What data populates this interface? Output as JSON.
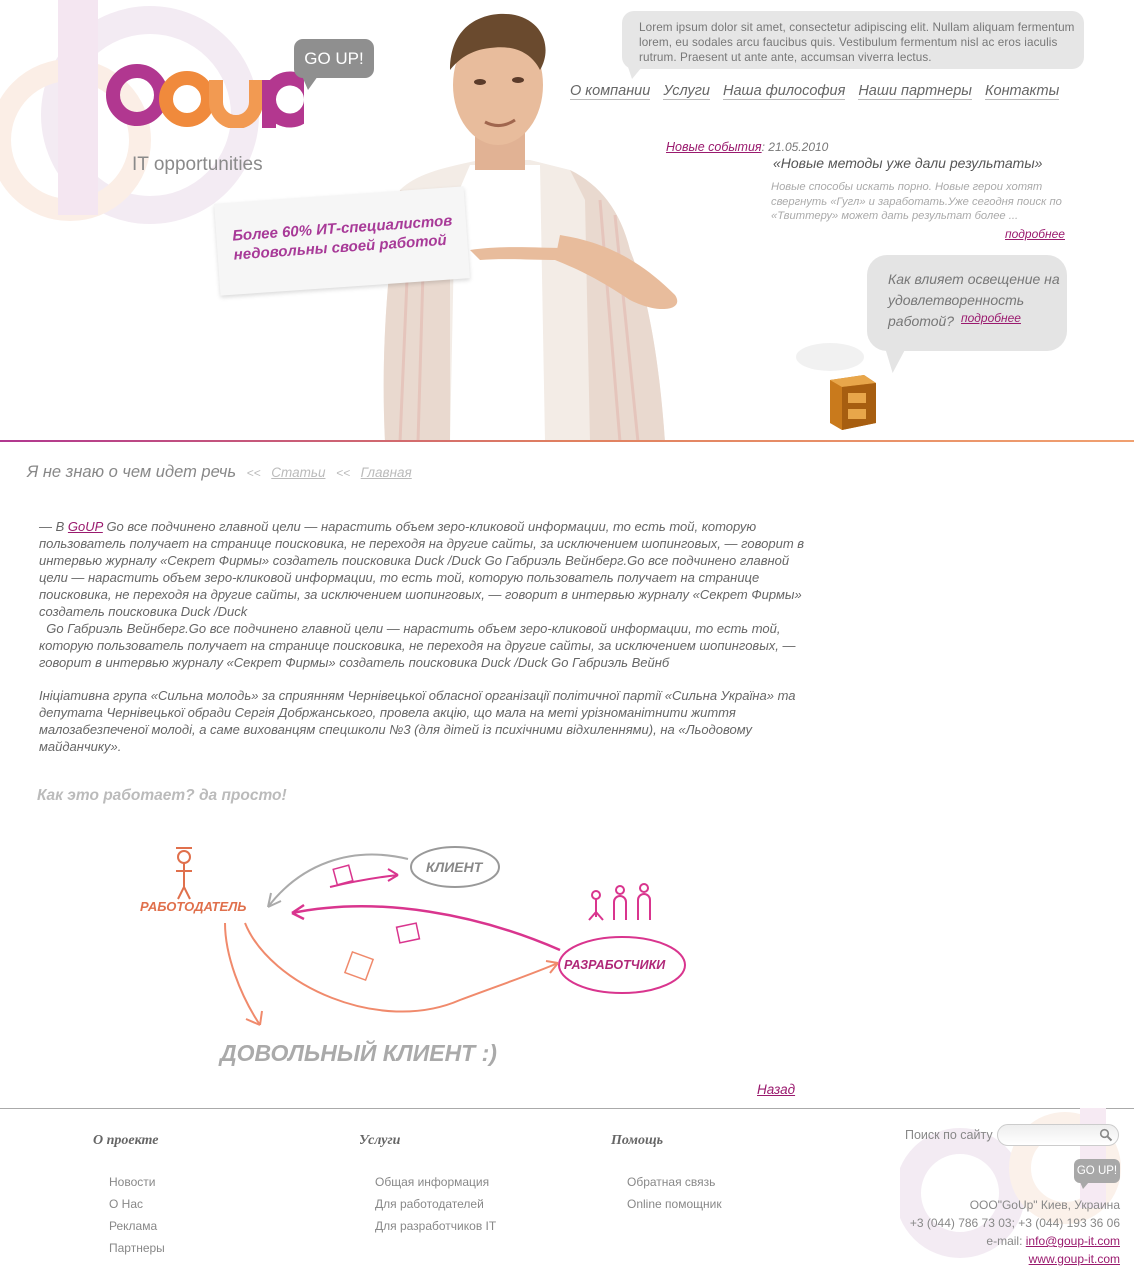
{
  "header": {
    "logo_text": "GoUp",
    "logo_tagline": "IT opportunities",
    "logo_bubble": "GO UP!",
    "lorem": "Lorem ipsum dolor sit amet, consectetur adipiscing elit. Nullam aliquam fermentum lorem, eu sodales arcu faucibus quis. Vestibulum fermentum nisl ac eros iaculis rutrum. Praesent ut ante ante, accumsan viverra lectus.",
    "card_text_1": "Более 60% ИТ-специалистов",
    "card_text_2": "недовольны своей работой"
  },
  "nav": {
    "items": [
      "О компании",
      "Услуги",
      "Наша философия",
      "Наши партнеры",
      "Контакты"
    ]
  },
  "news": {
    "label": "Новые события",
    "date": "21.05.2010",
    "title": "«Новые методы уже дали результаты»",
    "text": "Новые способы искать порно. Новые герои хотят свергнуть «Гугл» и заработать.Уже сегодня поиск по «Твиттеру» может дать результат более ...",
    "more": "подробнее"
  },
  "question": {
    "text": "Как влияет освещение на удовлетворенность работой?",
    "more": "подробнее"
  },
  "breadcrumbs": {
    "current": "Я не знаю о чем идет речь",
    "sep": "<<",
    "articles": "Статьи",
    "home": "Главная"
  },
  "article": {
    "p1_prefix": "— В ",
    "p1_link": "GoUP",
    "p1": " Go все подчинено главной цели — нарастить объем зеро-кликовой информации, то есть той, которую пользователь получает на странице поисковика, не переходя на другие сайты, за исключением шопинговых, — говорит в интервью журналу «Секрет Фирмы» создатель поисковика Duck /Duck Go Габриэль Вейнберг.Go все подчинено главной цели — нарастить объем зеро-кликовой информации, то есть той, которую пользователь получает на странице поисковика, не переходя на другие сайты, за исключением шопинговых, — говорит в интервью журналу «Секрет Фирмы» создатель поисковика Duck /Duck",
    "p1b": "Go Габриэль Вейнберг.Go все подчинено главной цели — нарастить объем зеро-кликовой информации, то есть той, которую пользователь получает на странице поисковика, не переходя на другие сайты, за исключением шопинговых, — говорит в интервью журналу «Секрет Фирмы» создатель поисковика Duck /Duck Go Габриэль Вейнб",
    "p2": "Ініціативна група «Сильна молодь» за сприянням Чернівецької обласної організації політичної партії «Сильна Україна» та депутата Чернівецької обради Сергія Добржанського, провела акцію, що мала на меті урізноманітнити життя малозабезпеченої молоді, а саме вихованцям спецшколи №3 (для дітей із психічними відхиленнями), на «Льодовому майданчику».",
    "howto": "Как это работает? да просто!"
  },
  "diagram": {
    "client": "КЛИЕНТ",
    "employer": "РАБОТОДАТЕЛЬ",
    "developers": "РАЗРАБОТЧИКИ",
    "result": "ДОВОЛЬНЫЙ КЛИЕНТ :)"
  },
  "back": "Назад",
  "footer": {
    "col1": {
      "title": "О проекте",
      "items": [
        "Новости",
        "О Нас",
        "Реклама",
        "Партнеры"
      ]
    },
    "col2": {
      "title": "Услуги",
      "items": [
        "Общая информация",
        "Для работодателей",
        "Для разработчиков IT"
      ]
    },
    "col3": {
      "title": "Помощь",
      "items": [
        "Обратная связь",
        "Online помощник"
      ]
    },
    "search_label": "Поиск по сайту",
    "goup_button": "GO UP!",
    "company": "ООО\"GoUp\" Киев, Украина",
    "phones": "+3 (044) 786 73 03; +3 (044) 193 36 06",
    "email_label": "e-mail: ",
    "email": "info@goup-it.com",
    "site": "www.goup-it.com"
  },
  "colors": {
    "brand_purple": "#b13790",
    "brand_orange": "#f08a3c",
    "link": "#9a1a6e"
  }
}
